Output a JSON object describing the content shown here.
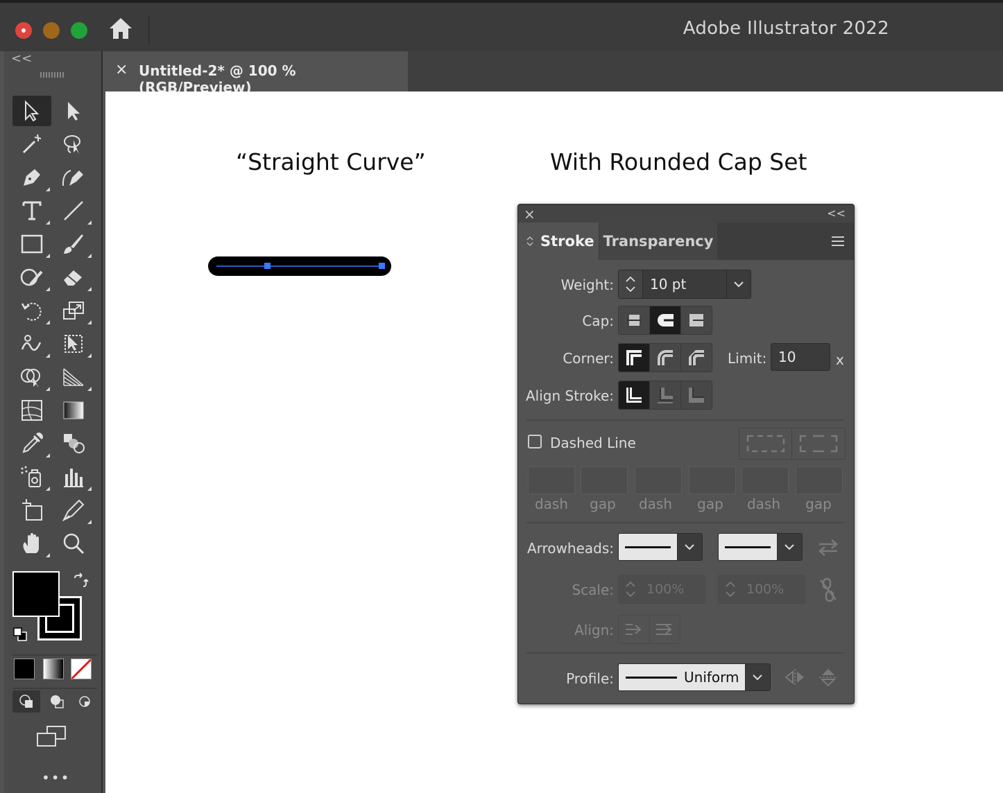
{
  "window": {
    "app_title": "Adobe Illustrator 2022",
    "traffic_lights": {
      "close": "#e0443e",
      "minimize": "#a0661a",
      "zoom": "#1fa33a"
    }
  },
  "document_tab": {
    "close_label": "×",
    "title": "Untitled-2* @ 100 % (RGB/Preview)"
  },
  "toolbar": {
    "collapse_label": "<<",
    "more_label": "•••",
    "tools": [
      "selection-tool",
      "direct-selection-tool",
      "magic-wand-tool",
      "lasso-tool",
      "pen-tool",
      "curvature-tool",
      "type-tool",
      "line-segment-tool",
      "rectangle-tool",
      "paintbrush-tool",
      "shaper-tool",
      "eraser-tool",
      "rotate-tool",
      "scale-tool",
      "warp-tool",
      "free-transform-tool",
      "shape-builder-tool",
      "perspective-grid-tool",
      "mesh-tool",
      "gradient-tool",
      "eyedropper-tool",
      "blend-tool",
      "symbol-sprayer-tool",
      "column-graph-tool",
      "artboard-tool",
      "slice-tool",
      "hand-tool",
      "zoom-tool"
    ],
    "fill_color": "#000000",
    "stroke_color": "#000000"
  },
  "canvas": {
    "heading_left": "“Straight Curve”",
    "heading_right": "With Rounded Cap Set"
  },
  "stroke_panel": {
    "close_label": "×",
    "collapse_label": "<<",
    "tabs": [
      {
        "label": "Stroke",
        "active": true
      },
      {
        "label": "Transparency",
        "active": false
      }
    ],
    "weight": {
      "label": "Weight:",
      "value": "10 pt"
    },
    "cap": {
      "label": "Cap:",
      "selected": "round-cap"
    },
    "corner": {
      "label": "Corner:",
      "selected": "miter-join"
    },
    "limit": {
      "label": "Limit:",
      "value": "10",
      "unit": "x"
    },
    "align_stroke": {
      "label": "Align Stroke:",
      "selected": "align-center"
    },
    "dashed_line": {
      "label": "Dashed Line",
      "checked": false
    },
    "dash_fields": [
      "dash",
      "gap",
      "dash",
      "gap",
      "dash",
      "gap"
    ],
    "arrowheads": {
      "label": "Arrowheads:"
    },
    "scale": {
      "label": "Scale:",
      "start": "100%",
      "end": "100%"
    },
    "align": {
      "label": "Align:"
    },
    "profile": {
      "label": "Profile:",
      "value": "Uniform"
    }
  }
}
